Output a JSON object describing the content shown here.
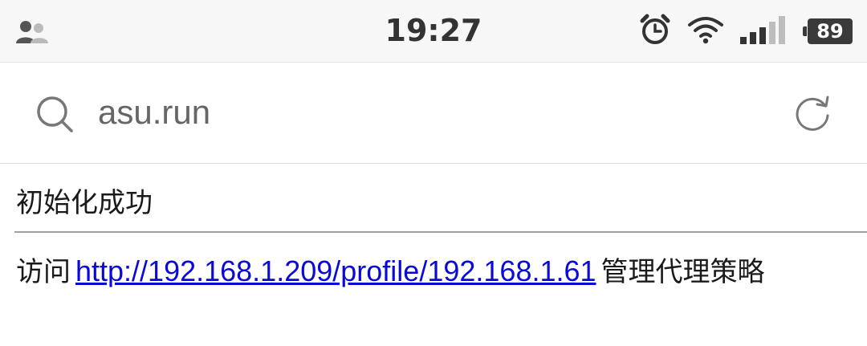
{
  "status_bar": {
    "time": "19:27",
    "battery_level": "89",
    "icons": [
      "contacts-icon",
      "alarm-icon",
      "wifi-icon",
      "signal-icon",
      "battery-icon"
    ]
  },
  "url_bar": {
    "url": "asu.run",
    "left_icon": "search-icon",
    "right_icon": "refresh-icon"
  },
  "page": {
    "status_message": "初始化成功",
    "visit_prefix": "访问",
    "link_text": "http://192.168.1.209/profile/192.168.1.61",
    "visit_suffix": "管理代理策略"
  },
  "colors": {
    "link": "#0a0ad8",
    "status_bar_bg": "#f7f7f7",
    "divider": "#a0a0a0"
  }
}
